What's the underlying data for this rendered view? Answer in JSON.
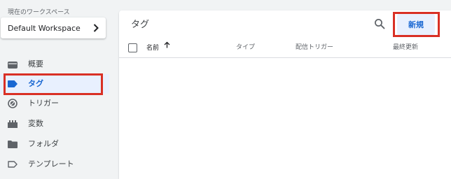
{
  "sidebar": {
    "workspace_caption": "現在のワークスペース",
    "workspace_name": "Default Workspace",
    "items": [
      {
        "label": "概要",
        "icon": "overview-icon"
      },
      {
        "label": "タグ",
        "icon": "tag-icon",
        "active": true
      },
      {
        "label": "トリガー",
        "icon": "trigger-icon"
      },
      {
        "label": "変数",
        "icon": "variables-icon"
      },
      {
        "label": "フォルダ",
        "icon": "folder-icon"
      },
      {
        "label": "テンプレート",
        "icon": "template-icon"
      }
    ]
  },
  "main": {
    "title": "タグ",
    "new_button": "新規",
    "columns": {
      "name": "名前",
      "type": "タイプ",
      "trigger": "配信トリガー",
      "updated": "最終更新"
    },
    "rows": []
  },
  "colors": {
    "accent": "#1967d2",
    "active_bg": "#e8f0fe",
    "highlight": "#d93025",
    "icon": "#5f6368"
  }
}
